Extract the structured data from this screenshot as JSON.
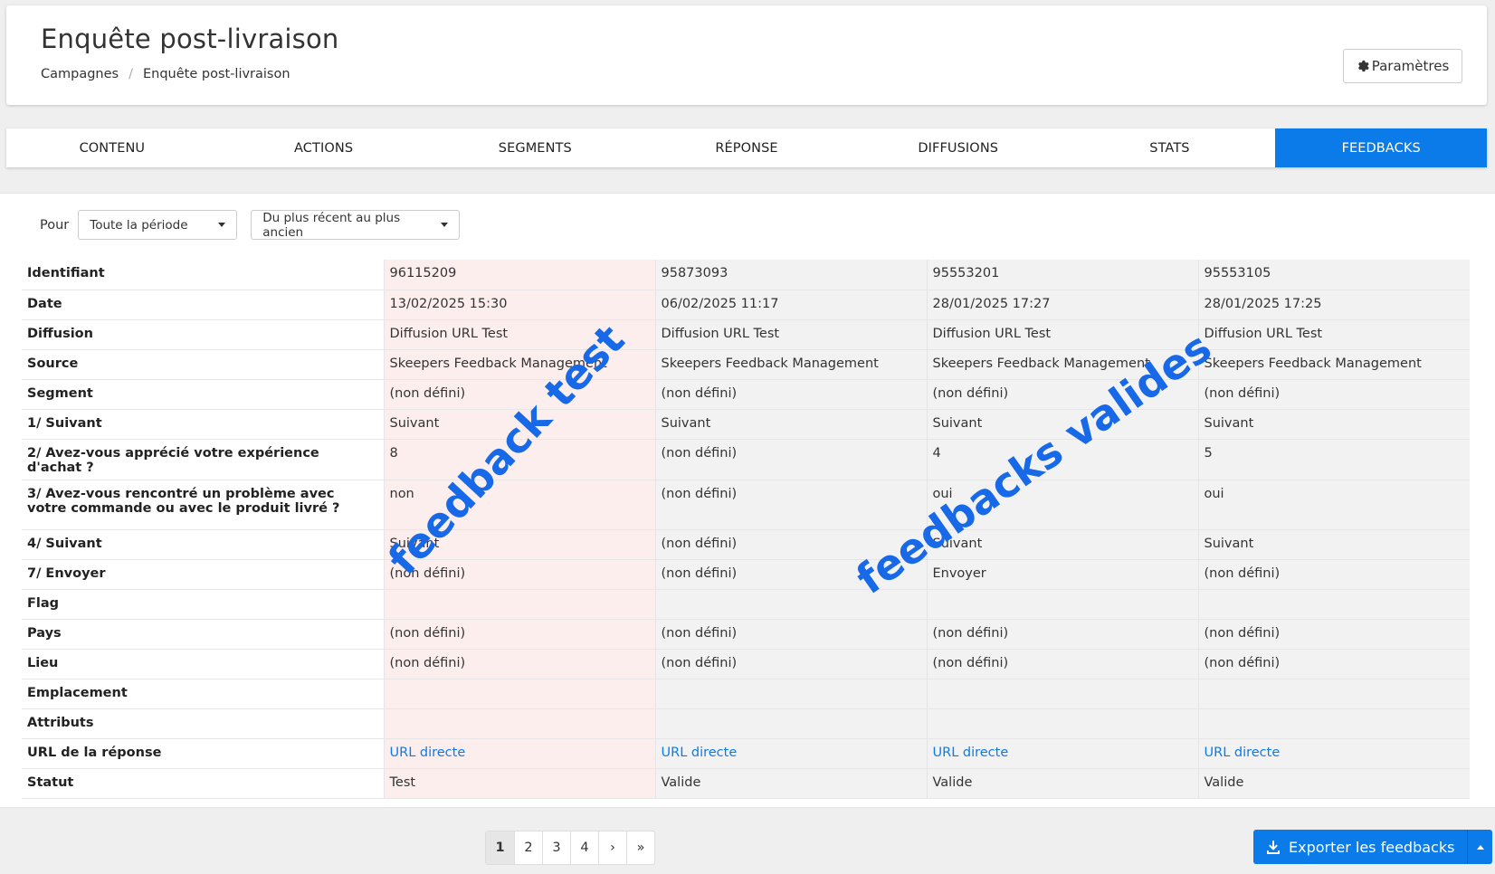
{
  "header": {
    "title": "Enquête post-livraison",
    "breadcrumb": [
      "Campagnes",
      "Enquête post-livraison"
    ],
    "settings_label": "Paramètres",
    "settings_icon": "gear-icon"
  },
  "tabs": [
    {
      "label": "CONTENU",
      "active": false
    },
    {
      "label": "ACTIONS",
      "active": false
    },
    {
      "label": "SEGMENTS",
      "active": false
    },
    {
      "label": "RÉPONSE",
      "active": false
    },
    {
      "label": "DIFFUSIONS",
      "active": false
    },
    {
      "label": "STATS",
      "active": false
    },
    {
      "label": "FEEDBACKS",
      "active": true
    }
  ],
  "filters": {
    "for_label": "Pour",
    "period": "Toute la période",
    "sort": "Du plus récent au plus ancien"
  },
  "table": {
    "row_headers": [
      "Identifiant",
      "Date",
      "Diffusion",
      "Source",
      "Segment",
      "1/ Suivant",
      "2/ Avez-vous apprécié votre expérience d'achat ?",
      "3/ Avez-vous rencontré un problème avec votre commande ou avec le produit livré ?",
      "4/ Suivant",
      "7/ Envoyer",
      "Flag",
      "Pays",
      "Lieu",
      "Emplacement",
      "Attributs",
      "URL de la réponse",
      "Statut"
    ],
    "columns": [
      [
        "96115209",
        "13/02/2025 15:30",
        "Diffusion URL Test",
        "Skeepers Feedback Management",
        "(non défini)",
        "Suivant",
        "8",
        "non",
        "Suivant",
        "(non défini)",
        "",
        "(non défini)",
        "(non défini)",
        "",
        "",
        "URL directe",
        "Test"
      ],
      [
        "95873093",
        "06/02/2025 11:17",
        "Diffusion URL Test",
        "Skeepers Feedback Management",
        "(non défini)",
        "Suivant",
        "(non défini)",
        "(non défini)",
        "(non défini)",
        "(non défini)",
        "",
        "(non défini)",
        "(non défini)",
        "",
        "",
        "URL directe",
        "Valide"
      ],
      [
        "95553201",
        "28/01/2025 17:27",
        "Diffusion URL Test",
        "Skeepers Feedback Management",
        "(non défini)",
        "Suivant",
        "4",
        "oui",
        "Suivant",
        "Envoyer",
        "",
        "(non défini)",
        "(non défini)",
        "",
        "",
        "URL directe",
        "Valide"
      ],
      [
        "95553105",
        "28/01/2025 17:25",
        "Diffusion URL Test",
        "Skeepers Feedback Management",
        "(non défini)",
        "Suivant",
        "5",
        "oui",
        "Suivant",
        "(non défini)",
        "",
        "(non défini)",
        "(non défini)",
        "",
        "",
        "URL directe",
        "Valide"
      ]
    ]
  },
  "annotations": {
    "test": "feedback test",
    "valid": "feedbacks valides"
  },
  "pagination": {
    "pages": [
      "1",
      "2",
      "3",
      "4"
    ],
    "current": "1",
    "next": "›",
    "last": "»"
  },
  "export": {
    "label": "Exporter les feedbacks",
    "icon": "download-icon"
  },
  "colors": {
    "accent": "#0b7bea",
    "test_column_bg": "#fdeeee",
    "annotation": "#1769e8"
  }
}
